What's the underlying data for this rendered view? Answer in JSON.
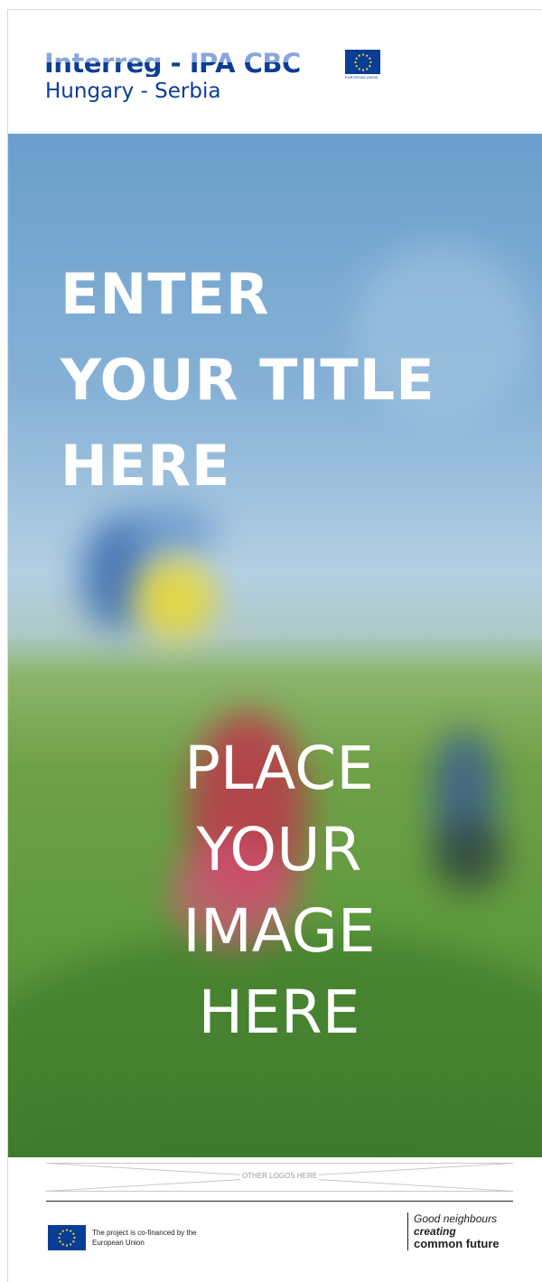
{
  "header": {
    "program_name": "Interreg - IPA CBC",
    "region": "Hungary - Serbia",
    "eu_label": "EUROPEAN UNION",
    "eu_flag_icon": "eu-flag-icon"
  },
  "poster": {
    "title_lines": [
      "ENTER",
      "YOUR TITLE",
      "HERE"
    ],
    "image_placeholder_lines": [
      "PLACE",
      "YOUR",
      "IMAGE",
      "HERE"
    ]
  },
  "logos": {
    "label": "OTHER LOGOS HERE"
  },
  "footer": {
    "cofinanced_line1": "The project is co-financed by the",
    "cofinanced_line2": "European Union",
    "slogan_line1": "Good neighbours",
    "slogan_line2": "creating",
    "slogan_line3": "common future"
  },
  "colors": {
    "brand_blue": "#0a3d95",
    "brand_light_blue": "#8aa6dc",
    "title_text": "#ffffff"
  }
}
